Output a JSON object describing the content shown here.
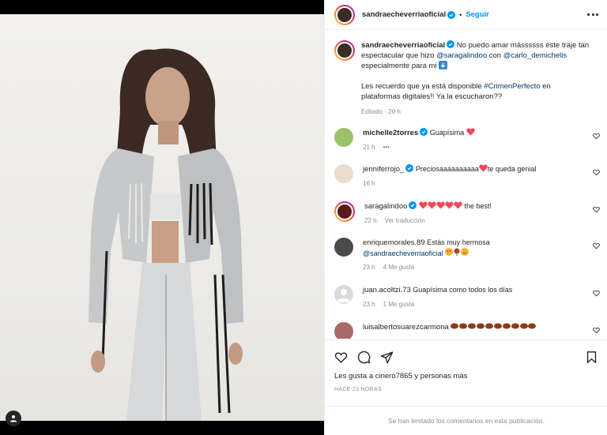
{
  "post": {
    "author": "sandraecheverriaoficial",
    "follow_label": "Seguir",
    "separator": "•",
    "caption": {
      "author": "sandraecheverriaoficial",
      "text1": "No puedo amar mássssss éste traje tan espectacular que hizo",
      "mention1": "@saragalindoo",
      "text2": "con",
      "mention2": "@carlo_demichelis",
      "text3": "especialmente para mi",
      "text4": "Les recuerdo que ya está disponible",
      "hashtag": "#CrimenPerfecto",
      "text5": "en plataformas digitales!! Ya la escucharon??",
      "meta_edited": "Editado",
      "meta_dot": "·",
      "meta_time": "20 h"
    }
  },
  "comments": [
    {
      "user": "michelle2torres",
      "text": "Guapísima",
      "time": "21 h",
      "extra": "•••",
      "likes": ""
    },
    {
      "user": "jenniferrojo_",
      "text_a": "Preciosaaaaaaaaaa",
      "text_b": "te queda genial",
      "time": "16 h"
    },
    {
      "user": "saragalindoo",
      "text": "the best!",
      "time": "22 h",
      "translate": "Ver traducción"
    },
    {
      "user": "enriquemorales.89",
      "text": "Estás muy hermosa",
      "mention": "@sandraecheverriaoficial",
      "time": "23 h",
      "likes": "4 Me gusta"
    },
    {
      "user": "juan.acoltzi.73",
      "text": "Guapísima como todos los días",
      "time": "23 h",
      "likes": "1 Me gusta"
    },
    {
      "user": "luisalbertosuarezcarmona",
      "text": ""
    }
  ],
  "footer": {
    "likes_text": "Les gusta a cinero7865 y personas más",
    "time_ago": "HACE 23 HORAS",
    "limited": "Se han limitado los comentarios en esta publicación."
  },
  "colors": {
    "link": "#00376b",
    "follow": "#0095f6",
    "heart_red": "#ed4956",
    "muted": "#8e8e8e"
  },
  "icons": [
    "verified-badge-icon",
    "more-options-icon",
    "heart-icon",
    "comment-icon",
    "share-icon",
    "bookmark-icon",
    "tag-user-icon"
  ]
}
